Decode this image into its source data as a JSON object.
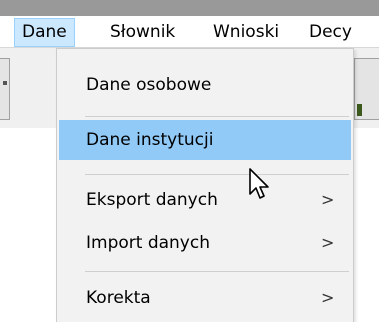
{
  "menubar": {
    "items": [
      {
        "label": "Dane",
        "active": true
      },
      {
        "label": "Słownik"
      },
      {
        "label": "Wnioski"
      },
      {
        "label": "Decy"
      }
    ]
  },
  "dropdown": {
    "items": [
      {
        "label": "Dane osobowe",
        "submenu_arrow": ""
      },
      {
        "label": "Dane instytucji",
        "submenu_arrow": "",
        "highlighted": true
      },
      {
        "label": "Eksport danych",
        "submenu_arrow": ">"
      },
      {
        "label": "Import danych",
        "submenu_arrow": ">"
      },
      {
        "label": "Korekta",
        "submenu_arrow": ">"
      }
    ]
  },
  "colors": {
    "menubar_active_bg": "#cce8ff",
    "menubar_active_border": "#99d1ff",
    "dropdown_bg": "#f2f2f2",
    "highlight_bg": "#91c9f7",
    "titlebar": "#999999"
  },
  "icons": {
    "cursor": "mouse-pointer-icon"
  }
}
